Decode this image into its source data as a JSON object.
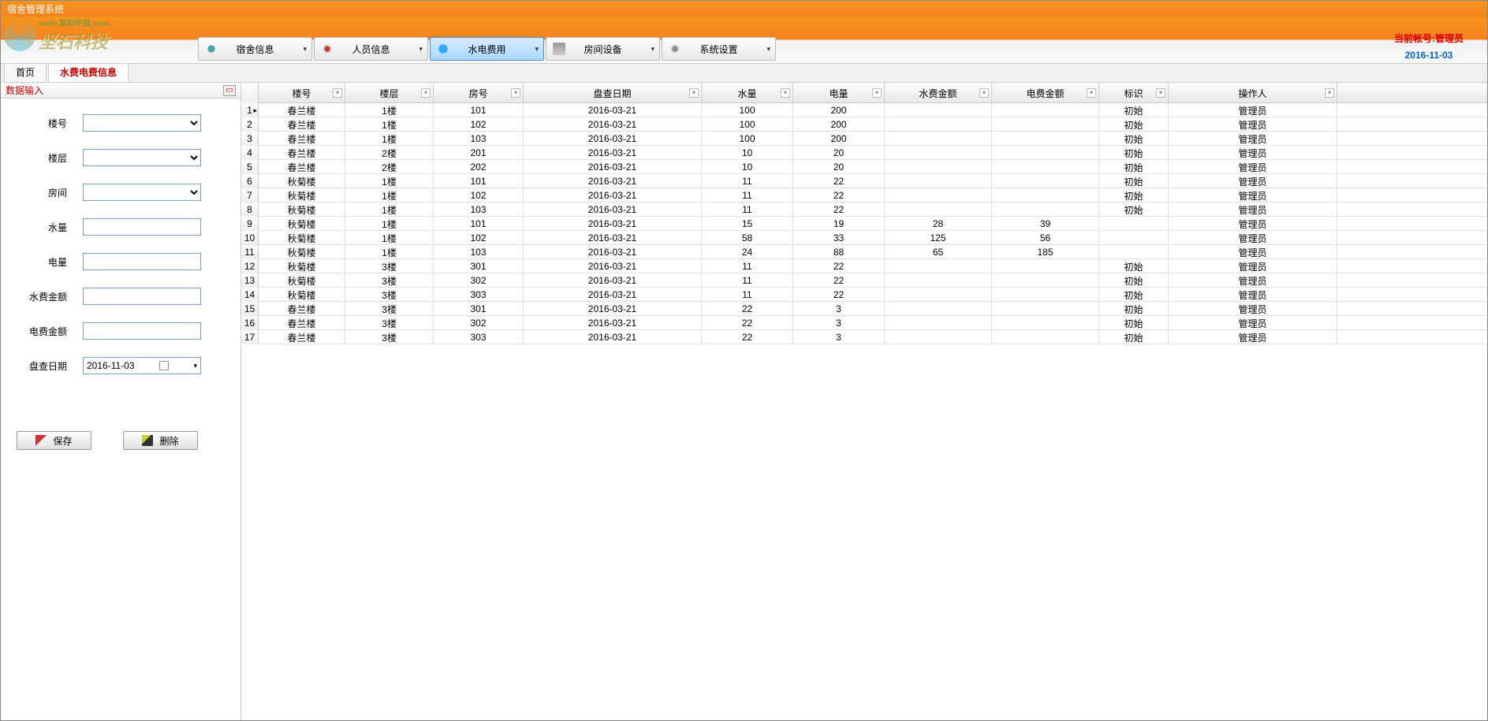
{
  "title_bar": "宿舍管理系统",
  "logo": {
    "cn": "坚石科技",
    "url": "www.某软件园.com"
  },
  "toolbar": [
    {
      "id": "dorm",
      "label": "宿舍信息",
      "icon": "blue",
      "active": false
    },
    {
      "id": "staff",
      "label": "人员信息",
      "icon": "hat",
      "active": false
    },
    {
      "id": "util",
      "label": "水电费用",
      "icon": "drop",
      "active": true
    },
    {
      "id": "equip",
      "label": "房间设备",
      "icon": "print",
      "active": false
    },
    {
      "id": "sys",
      "label": "系统设置",
      "icon": "gear",
      "active": false
    }
  ],
  "account": {
    "line": "当前帐号:管理员",
    "date": "2016-11-03"
  },
  "tabs": [
    {
      "label": "首页",
      "active": false
    },
    {
      "label": "水费电费信息",
      "active": true
    }
  ],
  "panel_title": "数据输入",
  "form": {
    "fields": [
      {
        "label": "楼号",
        "type": "select",
        "value": ""
      },
      {
        "label": "楼层",
        "type": "select",
        "value": ""
      },
      {
        "label": "房间",
        "type": "select",
        "value": ""
      },
      {
        "label": "水量",
        "type": "text",
        "value": ""
      },
      {
        "label": "电量",
        "type": "text",
        "value": ""
      },
      {
        "label": "水费金额",
        "type": "text",
        "value": ""
      },
      {
        "label": "电费金额",
        "type": "text",
        "value": ""
      },
      {
        "label": "盘查日期",
        "type": "date",
        "value": "2016-11-03"
      }
    ],
    "buttons": {
      "save": "保存",
      "del": "删除"
    }
  },
  "grid": {
    "columns": [
      "楼号",
      "楼层",
      "房号",
      "盘查日期",
      "水量",
      "电量",
      "水费金额",
      "电费金额",
      "标识",
      "操作人"
    ],
    "rows": [
      {
        "n": 1,
        "sel": true,
        "d": [
          "春兰楼",
          "1楼",
          "101",
          "2016-03-21",
          "100",
          "200",
          "",
          "",
          "初始",
          "管理员"
        ]
      },
      {
        "n": 2,
        "d": [
          "春兰楼",
          "1楼",
          "102",
          "2016-03-21",
          "100",
          "200",
          "",
          "",
          "初始",
          "管理员"
        ]
      },
      {
        "n": 3,
        "d": [
          "春兰楼",
          "1楼",
          "103",
          "2016-03-21",
          "100",
          "200",
          "",
          "",
          "初始",
          "管理员"
        ]
      },
      {
        "n": 4,
        "d": [
          "春兰楼",
          "2楼",
          "201",
          "2016-03-21",
          "10",
          "20",
          "",
          "",
          "初始",
          "管理员"
        ]
      },
      {
        "n": 5,
        "d": [
          "春兰楼",
          "2楼",
          "202",
          "2016-03-21",
          "10",
          "20",
          "",
          "",
          "初始",
          "管理员"
        ]
      },
      {
        "n": 6,
        "d": [
          "秋菊楼",
          "1楼",
          "101",
          "2016-03-21",
          "11",
          "22",
          "",
          "",
          "初始",
          "管理员"
        ]
      },
      {
        "n": 7,
        "d": [
          "秋菊楼",
          "1楼",
          "102",
          "2016-03-21",
          "11",
          "22",
          "",
          "",
          "初始",
          "管理员"
        ]
      },
      {
        "n": 8,
        "d": [
          "秋菊楼",
          "1楼",
          "103",
          "2016-03-21",
          "11",
          "22",
          "",
          "",
          "初始",
          "管理员"
        ]
      },
      {
        "n": 9,
        "d": [
          "秋菊楼",
          "1楼",
          "101",
          "2016-03-21",
          "15",
          "19",
          "28",
          "39",
          "",
          "管理员"
        ]
      },
      {
        "n": 10,
        "d": [
          "秋菊楼",
          "1楼",
          "102",
          "2016-03-21",
          "58",
          "33",
          "125",
          "56",
          "",
          "管理员"
        ]
      },
      {
        "n": 11,
        "d": [
          "秋菊楼",
          "1楼",
          "103",
          "2016-03-21",
          "24",
          "88",
          "65",
          "185",
          "",
          "管理员"
        ]
      },
      {
        "n": 12,
        "d": [
          "秋菊楼",
          "3楼",
          "301",
          "2016-03-21",
          "11",
          "22",
          "",
          "",
          "初始",
          "管理员"
        ]
      },
      {
        "n": 13,
        "d": [
          "秋菊楼",
          "3楼",
          "302",
          "2016-03-21",
          "11",
          "22",
          "",
          "",
          "初始",
          "管理员"
        ]
      },
      {
        "n": 14,
        "d": [
          "秋菊楼",
          "3楼",
          "303",
          "2016-03-21",
          "11",
          "22",
          "",
          "",
          "初始",
          "管理员"
        ]
      },
      {
        "n": 15,
        "d": [
          "春兰楼",
          "3楼",
          "301",
          "2016-03-21",
          "22",
          "3",
          "",
          "",
          "初始",
          "管理员"
        ]
      },
      {
        "n": 16,
        "d": [
          "春兰楼",
          "3楼",
          "302",
          "2016-03-21",
          "22",
          "3",
          "",
          "",
          "初始",
          "管理员"
        ]
      },
      {
        "n": 17,
        "d": [
          "春兰楼",
          "3楼",
          "303",
          "2016-03-21",
          "22",
          "3",
          "",
          "",
          "初始",
          "管理员"
        ]
      }
    ]
  }
}
